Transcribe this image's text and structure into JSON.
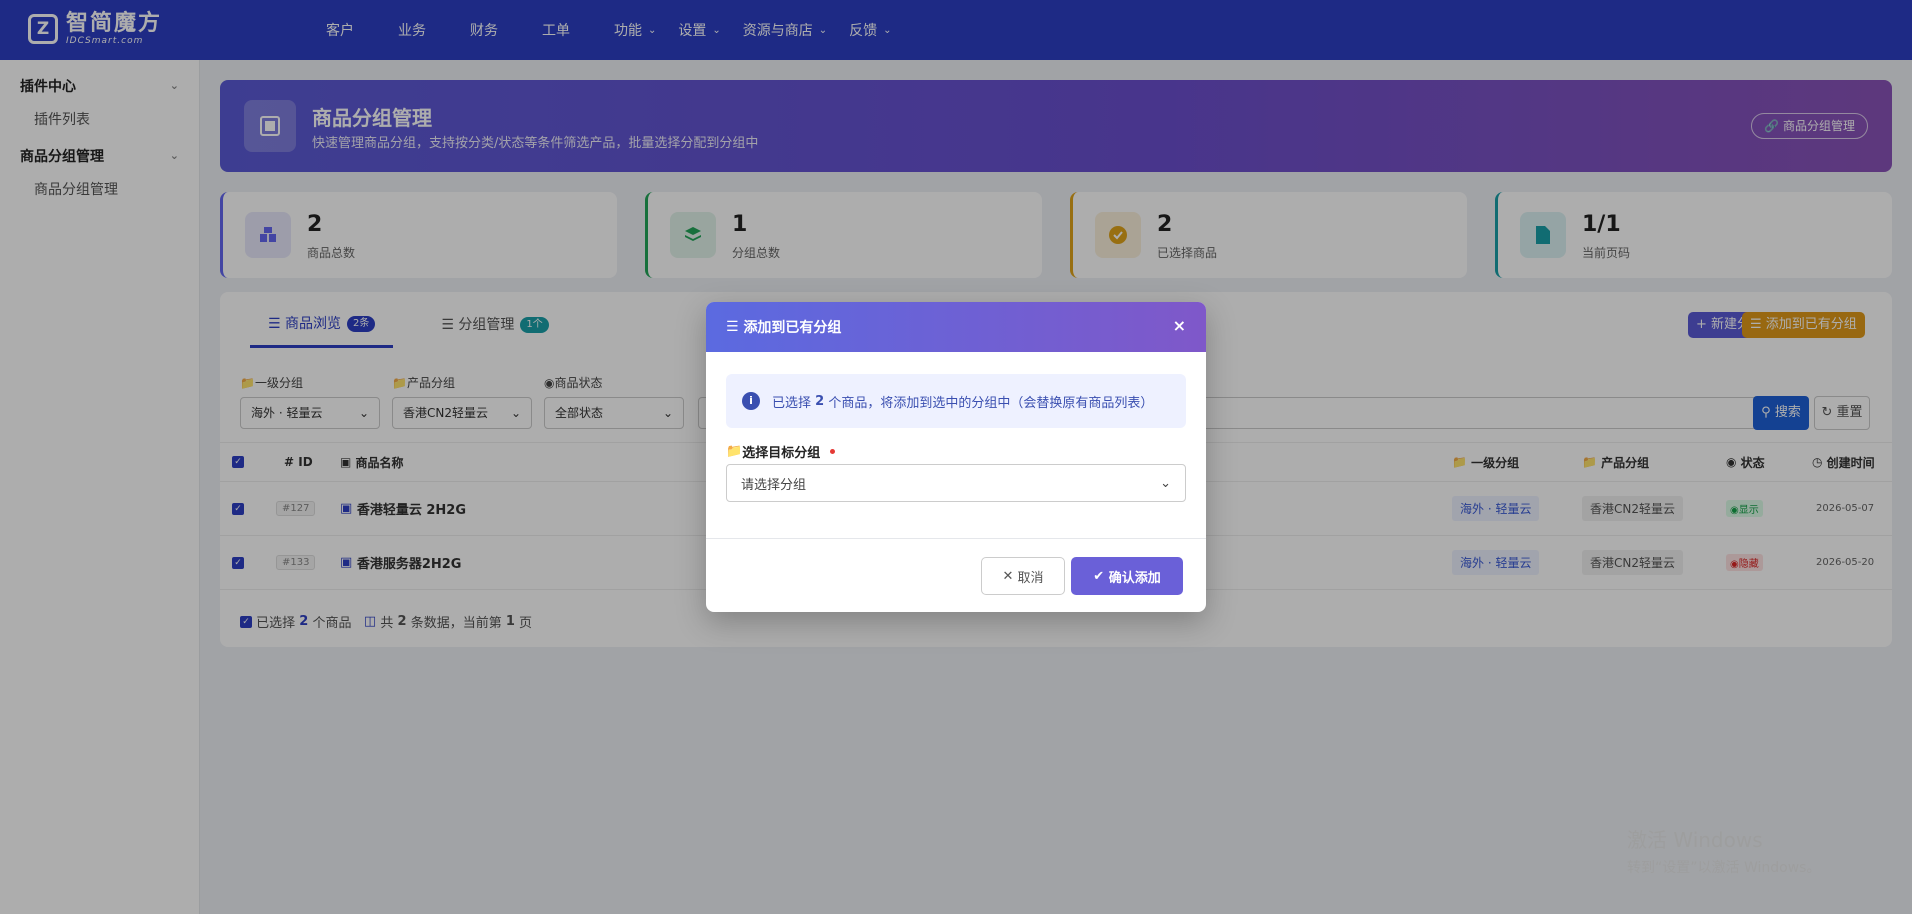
{
  "logo": {
    "main": "智简魔方",
    "sub": "IDCSmart.com"
  },
  "nav": [
    {
      "label": "客户",
      "dropdown": false
    },
    {
      "label": "业务",
      "dropdown": false
    },
    {
      "label": "财务",
      "dropdown": false
    },
    {
      "label": "工单",
      "dropdown": false
    },
    {
      "label": "功能",
      "dropdown": true
    },
    {
      "label": "设置",
      "dropdown": true
    },
    {
      "label": "资源与商店",
      "dropdown": true
    },
    {
      "label": "反馈",
      "dropdown": true
    }
  ],
  "sidebar": {
    "groups": [
      {
        "label": "插件中心",
        "items": [
          "插件列表"
        ]
      },
      {
        "label": "商品分组管理",
        "items": [
          "商品分组管理"
        ]
      }
    ]
  },
  "hero": {
    "title": "商品分组管理",
    "subtitle": "快速管理商品分组，支持按分类/状态等条件筛选产品，批量选择分配到分组中",
    "button": "商品分组管理"
  },
  "stats": [
    {
      "value": "2",
      "label": "商品总数",
      "color": "#6366f1"
    },
    {
      "value": "1",
      "label": "分组总数",
      "color": "#22a559"
    },
    {
      "value": "2",
      "label": "已选择商品",
      "color": "#e0a41a"
    },
    {
      "value": "1/1",
      "label": "当前页码",
      "color": "#1aa0a8"
    }
  ],
  "tabs": [
    {
      "label": "商品浏览",
      "badge": "2条",
      "active": true
    },
    {
      "label": "分组管理",
      "badge": "1个",
      "active": false
    }
  ],
  "actions": {
    "new_group": "新建分组",
    "add_existing": "添加到已有分组"
  },
  "filters": [
    {
      "label": "一级分组",
      "value": "海外 · 轻量云"
    },
    {
      "label": "产品分组",
      "value": "香港CN2轻量云"
    },
    {
      "label": "商品状态",
      "value": "全部状态"
    }
  ],
  "search": {
    "button": "搜索",
    "reset": "重置"
  },
  "table": {
    "headers": {
      "id": "ID",
      "name": "商品名称",
      "group1": "一级分组",
      "group2": "产品分组",
      "status": "状态",
      "created": "创建时间"
    },
    "rows": [
      {
        "id": "#127",
        "name": "香港轻量云 2H2G",
        "group1": "海外 · 轻量云",
        "group2": "香港CN2轻量云",
        "status": "显示",
        "created": "2026-05-07"
      },
      {
        "id": "#133",
        "name": "香港服务器2H2G",
        "group1": "海外 · 轻量云",
        "group2": "香港CN2轻量云",
        "status": "隐藏",
        "created": "2026-05-20"
      }
    ]
  },
  "footer": {
    "selected_prefix": "已选择",
    "selected_count": "2",
    "selected_suffix": "个商品",
    "total_prefix": "共",
    "total_count": "2",
    "total_mid": "条数据，当前第",
    "page": "1",
    "total_suffix": "页"
  },
  "modal": {
    "title": "添加到已有分组",
    "info_prefix": "已选择",
    "info_count": "2",
    "info_suffix": "个商品，将添加到选中的分组中（会替换原有商品列表）",
    "field_label": "选择目标分组",
    "select_placeholder": "请选择分组",
    "cancel": "取消",
    "confirm": "确认添加"
  },
  "watermark": {
    "line1": "激活 Windows",
    "line2": "转到“设置”以激活 Windows。"
  }
}
